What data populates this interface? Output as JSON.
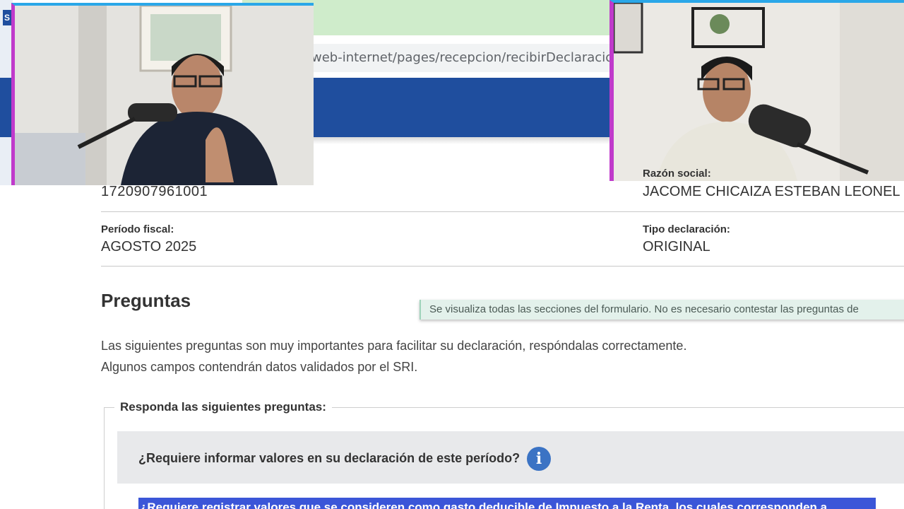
{
  "browser": {
    "url_fragment": "web-internet/pages/recepcion/recibirDeclaracion.jsf?id",
    "left_badge": "S"
  },
  "taxpayer": {
    "ruc_value": "1720907961001",
    "razon_social_label": "Razón social:",
    "razon_social_value": "JACOME CHICAIZA ESTEBAN LEONEL"
  },
  "period": {
    "periodo_label": "Período fiscal:",
    "periodo_value": "AGOSTO 2025",
    "tipo_label": "Tipo declaración:",
    "tipo_value": "ORIGINAL"
  },
  "questions": {
    "title": "Preguntas",
    "toast": "Se visualiza todas las secciones del formulario. No es necesario contestar las preguntas de",
    "intro_line1": "Las siguientes preguntas son muy importantes para facilitar su declaración, respóndalas correctamente.",
    "intro_line2": "Algunos campos contendrán datos validados por el SRI.",
    "legend": "Responda las siguientes preguntas:",
    "question1": "¿Requiere informar valores en su declaración de este período?",
    "info_icon": "i",
    "question2_partial": "¿Requiere registrar valores que se consideren como gasto deducible de Impuesto a la Renta, los cuales corresponden a"
  },
  "colors": {
    "header_blue": "#1f4e9e",
    "info_blue": "#3b73c4",
    "highlight_blue": "#3b56d8",
    "toast_bg": "#e3f1eb"
  }
}
